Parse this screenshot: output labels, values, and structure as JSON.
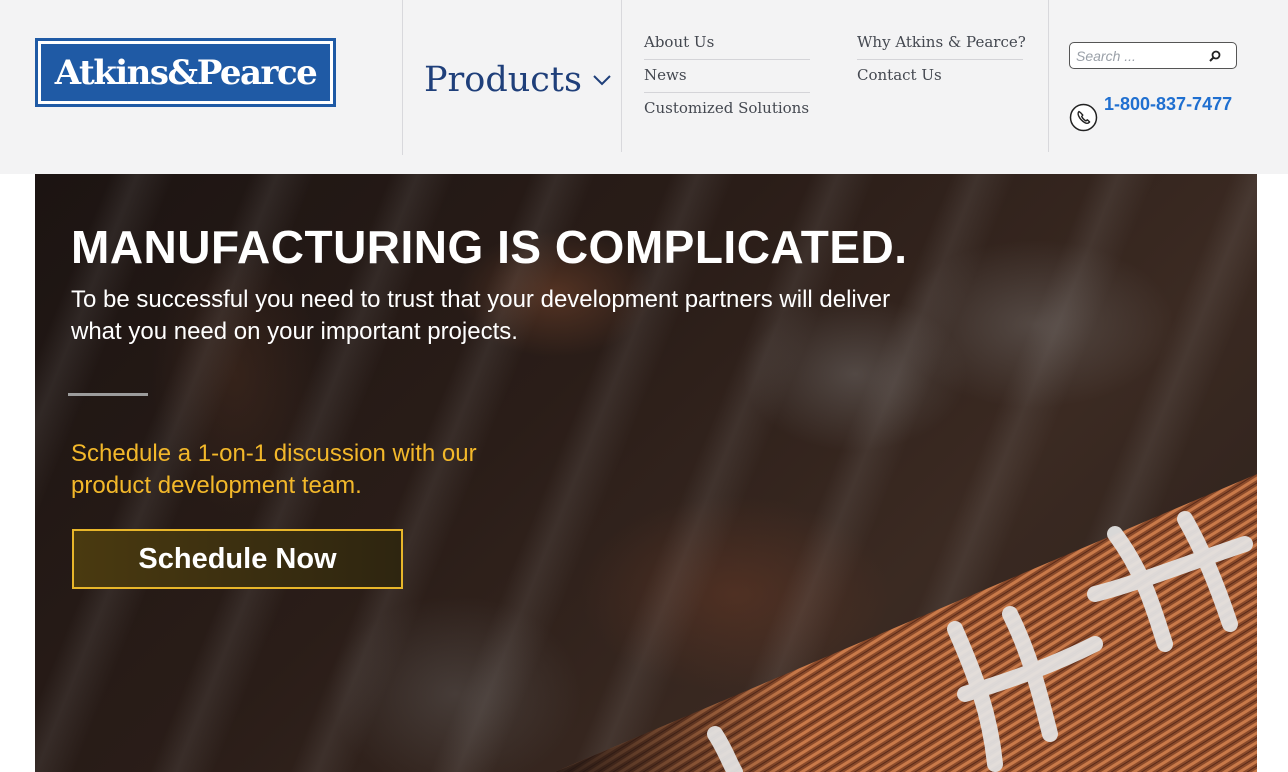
{
  "header": {
    "logo_text": "Atkins&Pearce",
    "products_label": "Products",
    "nav": {
      "about": "About Us",
      "news": "News",
      "customized": "Customized Solutions",
      "why": "Why Atkins & Pearce?",
      "contact": "Contact Us"
    },
    "search_placeholder": "Search ...",
    "phone": "1-800-837-7477"
  },
  "hero": {
    "title": "MANUFACTURING IS COMPLICATED.",
    "subtitle": "To be successful you need to trust that your development partners will deliver what you need on your important projects.",
    "cta_text": "Schedule a 1-on-1 discussion with our product development team.",
    "cta_button": "Schedule Now"
  },
  "colors": {
    "brand_blue": "#1f5aa5",
    "nav_blue": "#1f3f7a",
    "phone_blue": "#1f6fd0",
    "accent_gold": "#f3b82a",
    "header_bg": "#f3f3f4"
  },
  "icons": {
    "products_chevron": "chevron-down-icon",
    "search": "search-icon",
    "phone": "phone-icon"
  }
}
